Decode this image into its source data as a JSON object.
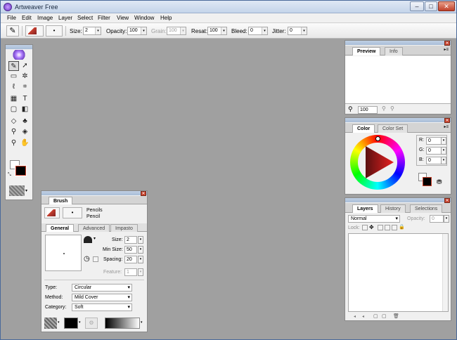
{
  "app": {
    "title": "Artweaver Free"
  },
  "window_controls": {
    "minimize": "–",
    "maximize": "□",
    "close": "✕"
  },
  "menu": [
    "File",
    "Edit",
    "Image",
    "Layer",
    "Select",
    "Filter",
    "View",
    "Window",
    "Help"
  ],
  "toolbar": {
    "size_label": "Size:",
    "size_value": "2",
    "opacity_label": "Opacity:",
    "opacity_value": "100",
    "grain_label": "Grain:",
    "grain_value": "100",
    "resat_label": "Resat:",
    "resat_value": "100",
    "bleed_label": "Bleed:",
    "bleed_value": "0",
    "jitter_label": "Jitter:",
    "jitter_value": "0"
  },
  "preview_panel": {
    "tabs": [
      "Preview",
      "Info"
    ],
    "zoom": "100"
  },
  "color_panel": {
    "tabs": [
      "Color",
      "Color Set"
    ],
    "r_label": "R:",
    "r_value": "0",
    "g_label": "G:",
    "g_value": "0",
    "b_label": "B:",
    "b_value": "0"
  },
  "layers_panel": {
    "tabs": [
      "Layers",
      "History",
      "Selections"
    ],
    "blend_mode": "Normal",
    "opacity_label": "Opacity:",
    "opacity_value": "0",
    "lock_label": "Lock:"
  },
  "brush_panel": {
    "title": "Brush",
    "category": "Pencils",
    "variant": "Pencil",
    "tabs": [
      "General",
      "Advanced",
      "Impasto"
    ],
    "size_label": "Size:",
    "size_value": "2",
    "min_size_label": "Min Size:",
    "min_size_value": "50",
    "spacing_label": "Spacing:",
    "spacing_value": "20",
    "feature_label": "Feature:",
    "feature_value": "1",
    "type_label": "Type:",
    "type_value": "Circular",
    "method_label": "Method:",
    "method_value": "Mild Cover",
    "category_label": "Category:",
    "category_value": "Soft"
  },
  "colors": {
    "canvas_bg": "#a0a0a0",
    "foreground": "#000000",
    "background": "#ffffff",
    "accent_red": "#c8402a"
  }
}
